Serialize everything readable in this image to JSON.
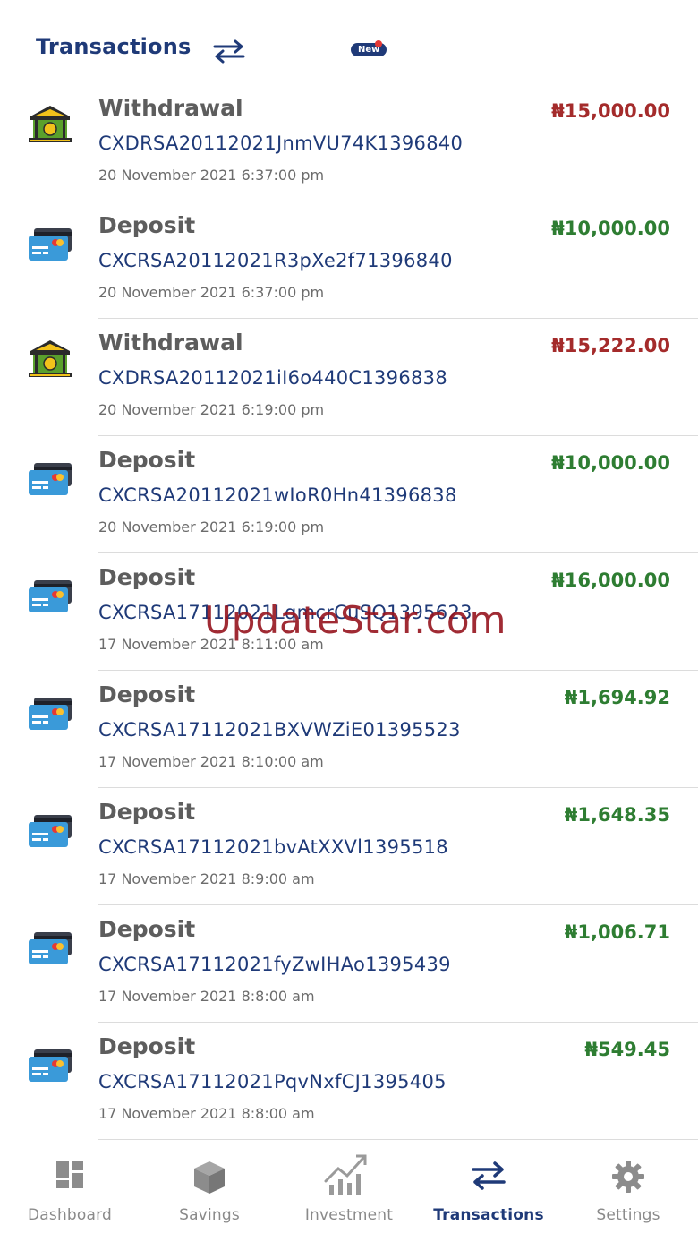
{
  "header": {
    "title": "Transactions"
  },
  "transactions": [
    {
      "type": "Withdrawal",
      "ref": "CXDRSA20112021JnmVU74K1396840",
      "date": "20 November 2021 6:37:00 pm",
      "amount": "₦15,000.00",
      "direction": "debit",
      "icon": "bank-icon"
    },
    {
      "type": "Deposit",
      "ref": "CXCRSA20112021R3pXe2f71396840",
      "date": "20 November 2021 6:37:00 pm",
      "amount": "₦10,000.00",
      "direction": "credit",
      "icon": "card-icon"
    },
    {
      "type": "Withdrawal",
      "ref": "CXDRSA20112021iI6o440C1396838",
      "date": "20 November 2021 6:19:00 pm",
      "amount": "₦15,222.00",
      "direction": "debit",
      "icon": "bank-icon"
    },
    {
      "type": "Deposit",
      "ref": "CXCRSA20112021wIoR0Hn41396838",
      "date": "20 November 2021 6:19:00 pm",
      "amount": "₦10,000.00",
      "direction": "credit",
      "icon": "card-icon"
    },
    {
      "type": "Deposit",
      "ref": "CXCRSA17112021LqmcrCuSQ1395623",
      "date": "17 November 2021 8:11:00 am",
      "amount": "₦16,000.00",
      "direction": "credit",
      "icon": "card-icon"
    },
    {
      "type": "Deposit",
      "ref": "CXCRSA17112021BXVWZiE01395523",
      "date": "17 November 2021 8:10:00 am",
      "amount": "₦1,694.92",
      "direction": "credit",
      "icon": "card-icon"
    },
    {
      "type": "Deposit",
      "ref": "CXCRSA17112021bvAtXXVl1395518",
      "date": "17 November 2021 8:9:00 am",
      "amount": "₦1,648.35",
      "direction": "credit",
      "icon": "card-icon"
    },
    {
      "type": "Deposit",
      "ref": "CXCRSA17112021fyZwIHAo1395439",
      "date": "17 November 2021 8:8:00 am",
      "amount": "₦1,006.71",
      "direction": "credit",
      "icon": "card-icon"
    },
    {
      "type": "Deposit",
      "ref": "CXCRSA17112021PqvNxfCJ1395405",
      "date": "17 November 2021 8:8:00 am",
      "amount": "₦549.45",
      "direction": "credit",
      "icon": "card-icon"
    }
  ],
  "watermark": "UpdateStar.com",
  "nav": {
    "items": [
      {
        "label": "Dashboard",
        "icon": "dashboard-icon",
        "active": false
      },
      {
        "label": "Savings",
        "icon": "savings-box-icon",
        "active": false
      },
      {
        "label": "Investment",
        "icon": "investment-chart-icon",
        "active": false,
        "badge": "New"
      },
      {
        "label": "Transactions",
        "icon": "transfer-arrows-icon",
        "active": true
      },
      {
        "label": "Settings",
        "icon": "gear-icon",
        "active": false
      }
    ]
  },
  "colors": {
    "primary": "#1f3a78",
    "debit": "#a42b2b",
    "credit": "#2e7d32",
    "muted": "#8a8a8a"
  }
}
